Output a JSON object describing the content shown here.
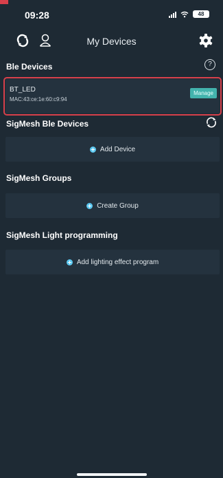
{
  "status": {
    "time": "09:28",
    "battery": "48"
  },
  "header": {
    "title": "My Devices"
  },
  "ble": {
    "title": "Ble Devices",
    "help": "?",
    "device": {
      "name": "BT_LED",
      "mac": "MAC:43:ce:1e:60:c9:94"
    },
    "manage_label": "Manage"
  },
  "sigmesh_devices": {
    "title": "SigMesh Ble Devices",
    "add_label": "Add Device"
  },
  "sigmesh_groups": {
    "title": "SigMesh Groups",
    "create_label": "Create Group"
  },
  "sigmesh_light": {
    "title": "SigMesh Light programming",
    "add_label": "Add lighting effect program"
  },
  "colors": {
    "background": "#1e2a34",
    "card": "#24323e",
    "accent": "#43b3ad",
    "highlight": "#d8404b",
    "plus": "#5cc8f0"
  }
}
